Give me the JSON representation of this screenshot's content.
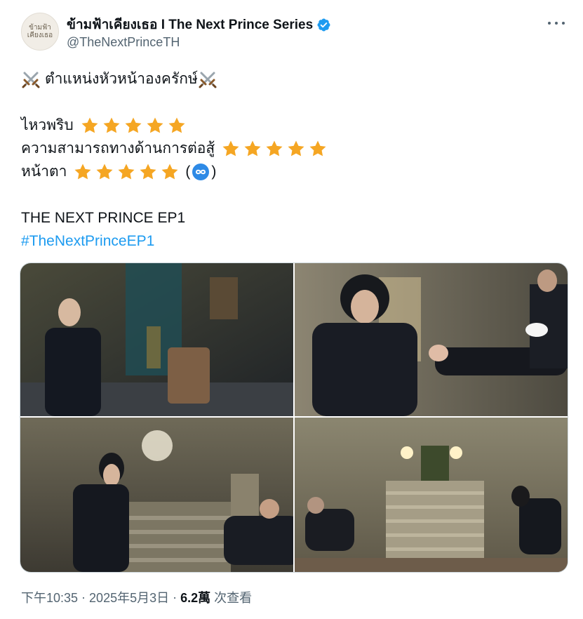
{
  "author": {
    "display_name": "ข้ามฟ้าเคียงเธอ I The Next Prince Series",
    "handle": "@TheNextPrinceTH",
    "avatar_text_line1": "ข้ามฟ้า",
    "avatar_text_line2": "เคียงเธอ",
    "verified_color": "#1d9bf0"
  },
  "tweet": {
    "title_line": "ตำแหน่งหัวหน้าองครักษ์",
    "rating_rows": [
      {
        "label": "ไหวพริบ",
        "stars": 5
      },
      {
        "label": "ความสามารถทางด้านการต่อสู้",
        "stars": 5
      },
      {
        "label": "หน้าตา",
        "stars": 5,
        "suffix_open": "(",
        "suffix_close": ")",
        "suffix_icon": "infinity-icon"
      }
    ],
    "episode_line": "THE NEXT PRINCE EP1",
    "hashtag": "#TheNextPrinceEP1",
    "emoji_icons": [
      "crossed-swords-icon",
      "star-icon",
      "infinity-icon"
    ]
  },
  "media": {
    "photo_count": 4
  },
  "footer": {
    "time": "下午10:35",
    "date": "2025年5月3日",
    "separator": "·",
    "views_count": "6.2萬",
    "views_label": "次查看"
  },
  "colors": {
    "link": "#1d9bf0",
    "secondary_text": "#536471",
    "star": "#f5a623"
  }
}
